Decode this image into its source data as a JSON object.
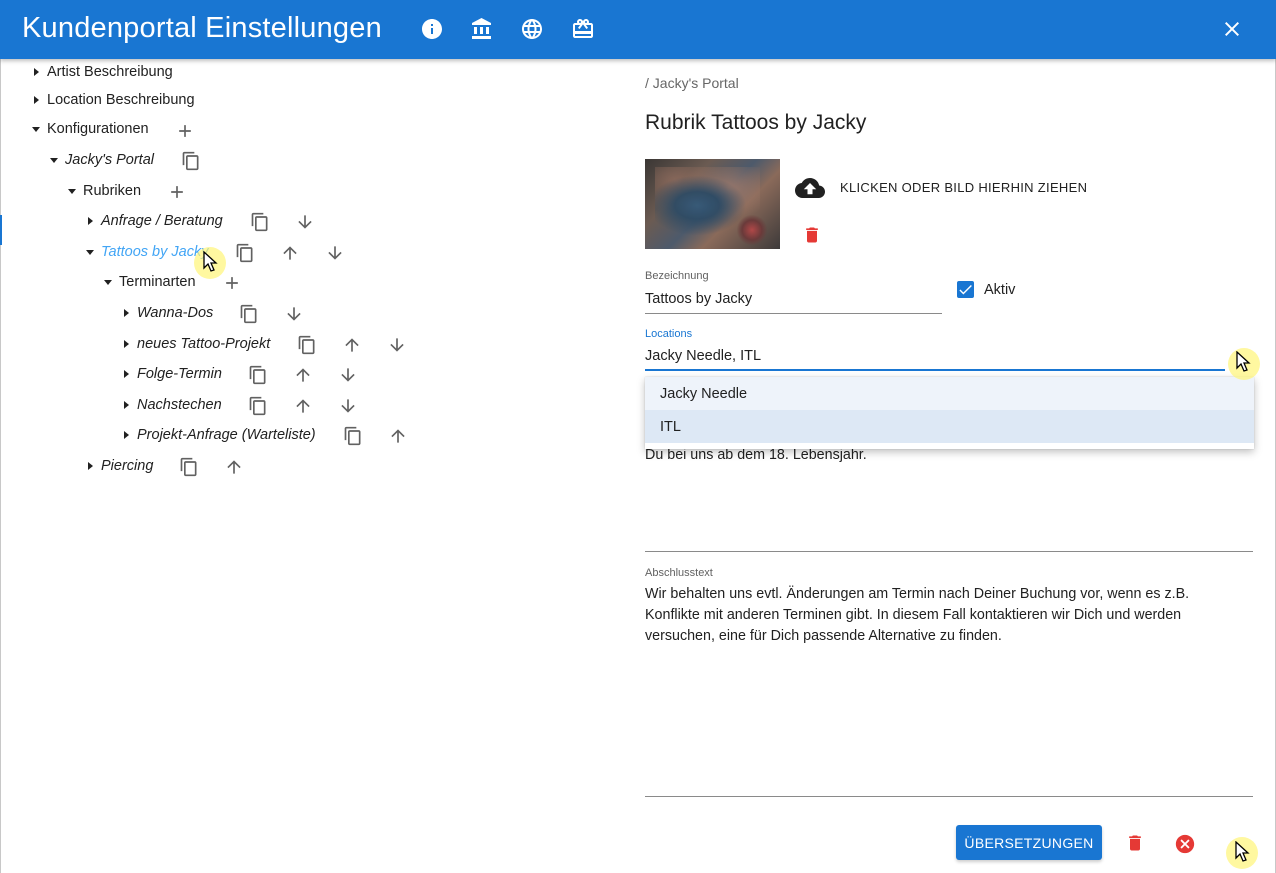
{
  "header": {
    "title": "Kundenportal Einstellungen",
    "icons": [
      "info-icon",
      "bank-icon",
      "globe-icon",
      "card-giftcard-icon"
    ],
    "close_icon": "close-icon"
  },
  "tree": {
    "artist": "Artist Beschreibung",
    "location": "Location Beschreibung",
    "konfigurationen": "Konfigurationen",
    "portal": "Jacky's Portal",
    "rubriken": "Rubriken",
    "anfrage": "Anfrage / Beratung",
    "tattoos": "Tattoos by Jacky",
    "terminarten": "Terminarten",
    "wanna": "Wanna-Dos",
    "neues": "neues Tattoo-Projekt",
    "folge": "Folge-Termin",
    "nachstechen": "Nachstechen",
    "projekt": "Projekt-Anfrage (Warteliste)",
    "piercing": "Piercing"
  },
  "detail": {
    "breadcrumb": "/ Jacky's Portal",
    "title": "Rubrik Tattoos by Jacky",
    "upload_text": "KLICKEN ODER BILD HIERHIN ZIEHEN",
    "bezeichnung_label": "Bezeichnung",
    "bezeichnung_value": "Tattoos by Jacky",
    "aktiv_label": "Aktiv",
    "aktiv_checked": true,
    "locations_label": "Locations",
    "locations_value": "Jacky Needle, ITL",
    "dropdown_options": [
      "Jacky Needle",
      "ITL"
    ],
    "partial_text": "Du bei uns ab dem 18. Lebensjahr.",
    "abschluss_label": "Abschlusstext",
    "abschluss_text": "Wir behalten uns evtl. Änderungen am Termin nach Deiner Buchung vor, wenn es z.B. Konflikte mit anderen Terminen gibt. In diesem Fall kontaktieren wir Dich und werden versuchen, eine für Dich passende Alternative zu finden.",
    "translations_button": "ÜBERSETZUNGEN"
  },
  "colors": {
    "primary": "#1976d2",
    "selected_node": "#42a5f5",
    "delete": "#e53935"
  }
}
